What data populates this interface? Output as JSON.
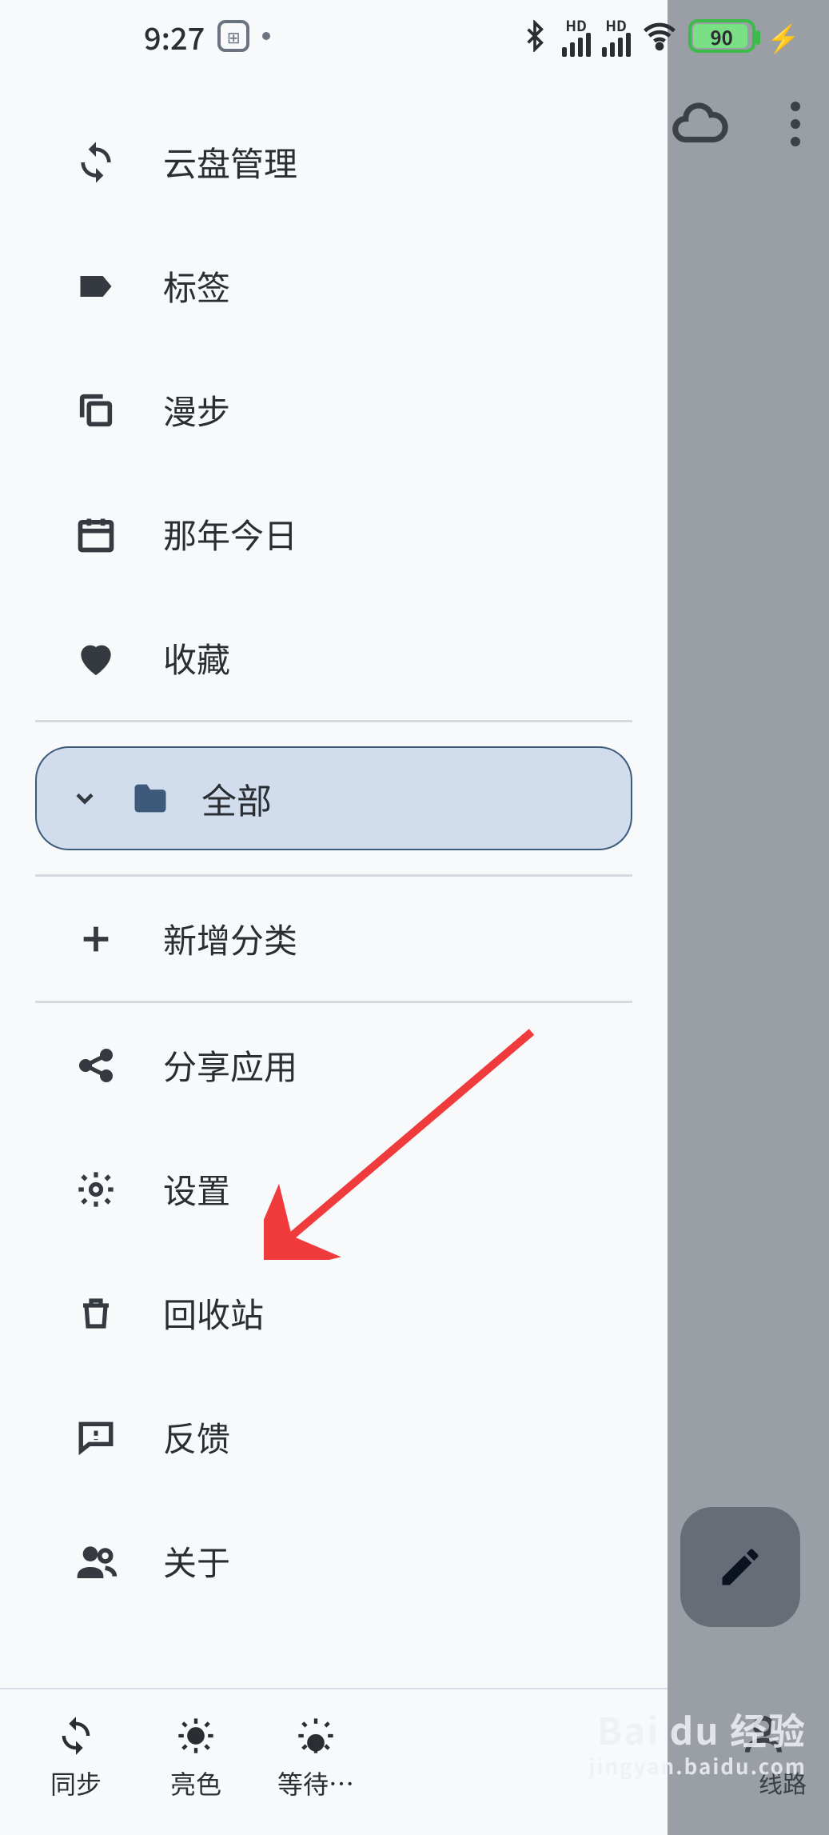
{
  "status": {
    "time": "9:27",
    "hd1": "HD",
    "hd2": "HD",
    "battery": "90"
  },
  "drawer": {
    "items": [
      {
        "label": "云盘管理"
      },
      {
        "label": "标签"
      },
      {
        "label": "漫步"
      },
      {
        "label": "那年今日"
      },
      {
        "label": "收藏"
      }
    ],
    "selected_folder": "全部",
    "add_category": "新增分类",
    "bottom_items": [
      {
        "label": "分享应用"
      },
      {
        "label": "设置"
      },
      {
        "label": "回收站"
      },
      {
        "label": "反馈"
      },
      {
        "label": "关于"
      }
    ],
    "footer": [
      {
        "label": "同步"
      },
      {
        "label": "亮色"
      },
      {
        "label": "等待…"
      }
    ]
  },
  "bg": {
    "profile_label": "线路"
  },
  "watermark": {
    "top": "Bai du 经验",
    "bot": "jingyan.baidu.com"
  }
}
